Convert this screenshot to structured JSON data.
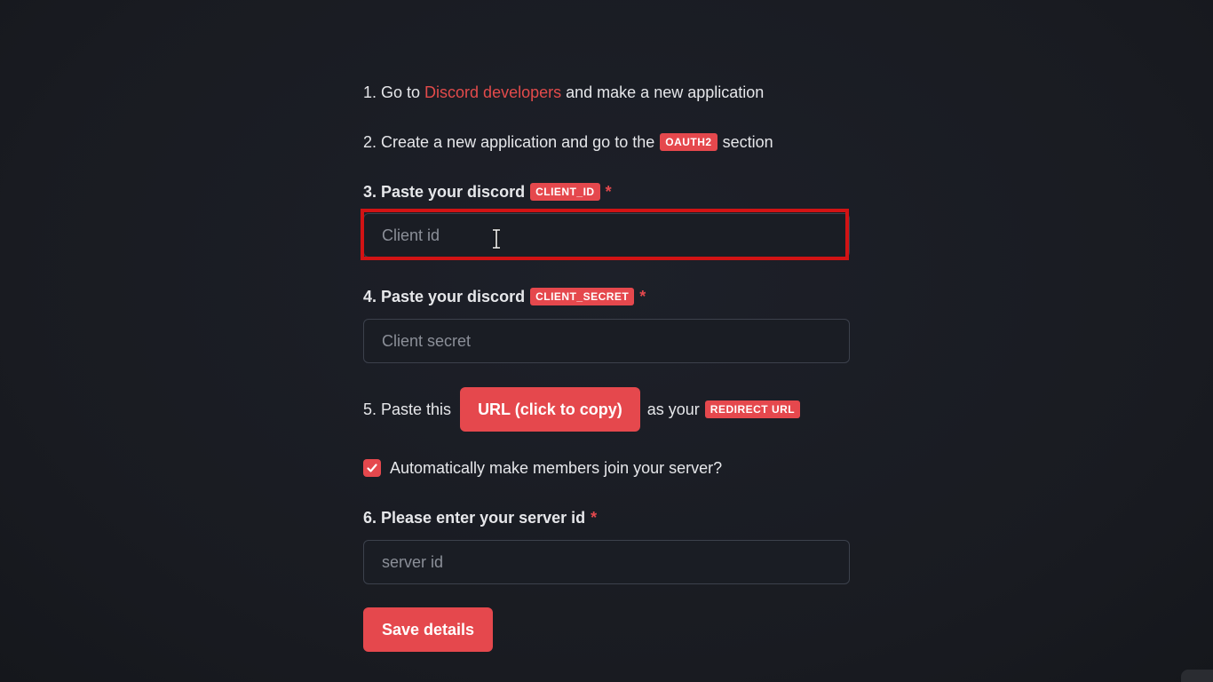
{
  "steps": {
    "s1": {
      "prefix": "1. Go to ",
      "link": "Discord developers",
      "suffix": " and make a new application"
    },
    "s2": {
      "prefix": "2. Create a new application and go to the",
      "tag": "OAUTH2",
      "suffix": "section"
    },
    "s3": {
      "prefix": "3. Paste your discord",
      "tag": "CLIENT_ID",
      "required": "*"
    },
    "s4": {
      "prefix": "4. Paste your discord",
      "tag": "CLIENT_SECRET",
      "required": "*"
    },
    "s5": {
      "prefix": "5. Paste this",
      "button": "URL (click to copy)",
      "middle": "as your",
      "tag": "REDIRECT URL"
    },
    "s6": {
      "prefix": "6. Please enter your server id",
      "required": "*"
    }
  },
  "inputs": {
    "client_id": {
      "placeholder": "Client id",
      "value": ""
    },
    "client_secret": {
      "placeholder": "Client secret",
      "value": ""
    },
    "server_id": {
      "placeholder": "server id",
      "value": ""
    }
  },
  "checkbox": {
    "label": "Automatically make members join your server?",
    "checked": true
  },
  "save_button": {
    "label": "Save details"
  },
  "colors": {
    "accent": "#e5484d",
    "highlight": "#d21314",
    "background": "#1a1d24"
  },
  "icons": {
    "cursor": "text-cursor-icon",
    "check": "checkmark-icon"
  }
}
